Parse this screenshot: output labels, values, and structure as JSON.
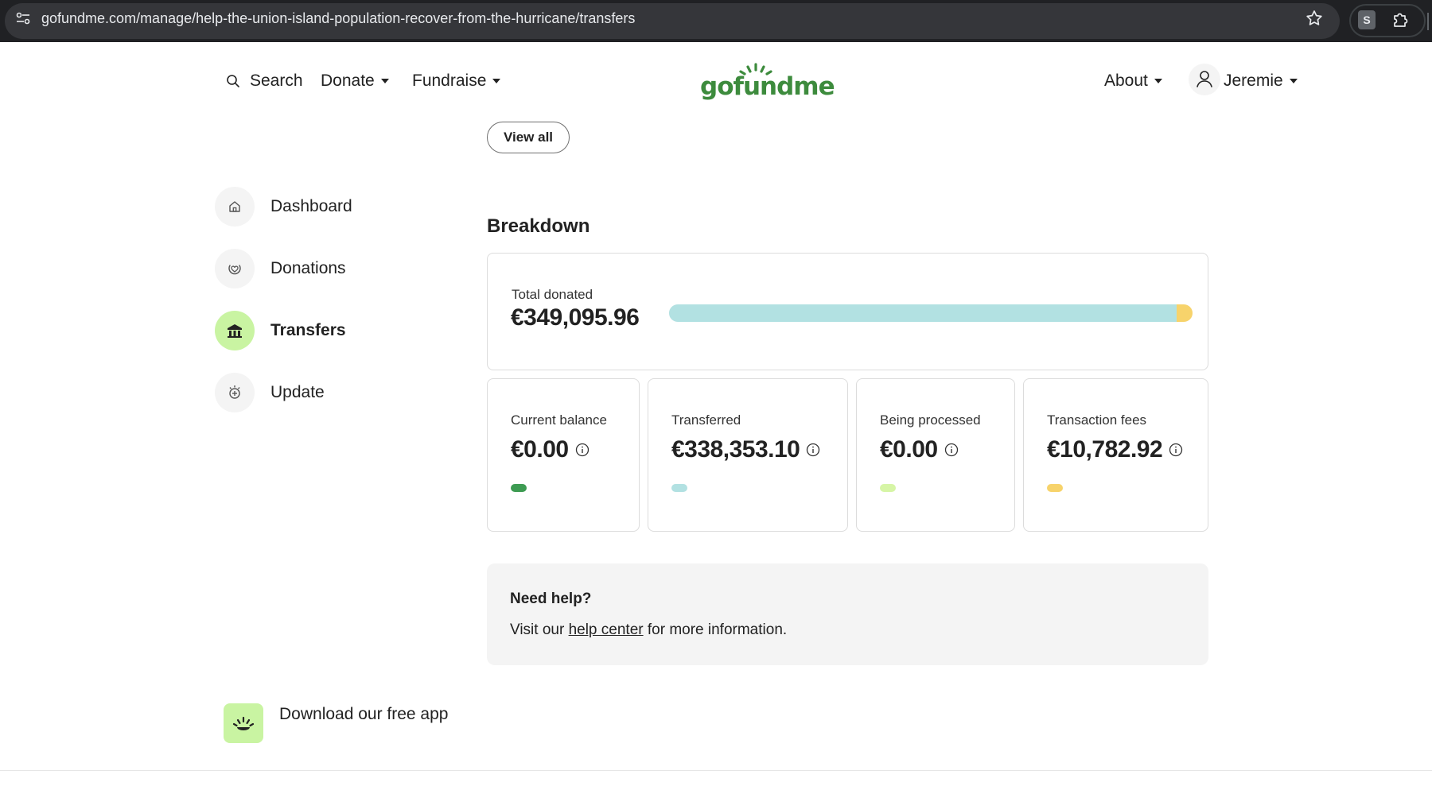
{
  "browser": {
    "url": "gofundme.com/manage/help-the-union-island-population-recover-from-the-hurricane/transfers",
    "extension_label": "S"
  },
  "nav": {
    "search": "Search",
    "donate": "Donate",
    "fundraise": "Fundraise",
    "logo": "gofundme",
    "about": "About",
    "user": "Jeremie"
  },
  "sidebar": {
    "items": [
      {
        "label": "Dashboard",
        "icon": "home-icon",
        "active": false
      },
      {
        "label": "Donations",
        "icon": "donation-heart-icon",
        "active": false
      },
      {
        "label": "Transfers",
        "icon": "bank-icon",
        "active": true
      },
      {
        "label": "Update",
        "icon": "update-add-icon",
        "active": false
      }
    ],
    "app_promo": "Download our free app"
  },
  "main": {
    "view_all": "View all",
    "breakdown_title": "Breakdown",
    "total_label": "Total donated",
    "total_value": "€349,095.96",
    "breakdown_bar": [
      {
        "name": "Transferred",
        "fraction": 0.9692,
        "color": "#b2e1e2"
      },
      {
        "name": "Transaction fees",
        "fraction": 0.0308,
        "color": "#f7d36b"
      }
    ],
    "stats": [
      {
        "label": "Current balance",
        "value": "€0.00",
        "color": "#3d9b52"
      },
      {
        "label": "Transferred",
        "value": "€338,353.10",
        "color": "#b2e1e2"
      },
      {
        "label": "Being processed",
        "value": "€0.00",
        "color": "#d6f5a6"
      },
      {
        "label": "Transaction fees",
        "value": "€10,782.92",
        "color": "#f7d36b"
      }
    ],
    "help": {
      "title": "Need help?",
      "text_before": "Visit our ",
      "link": "help center",
      "text_after": " for more information."
    }
  },
  "colors": {
    "brand": "#3d8b3d",
    "active_nav_bg": "#c9f4a2"
  }
}
